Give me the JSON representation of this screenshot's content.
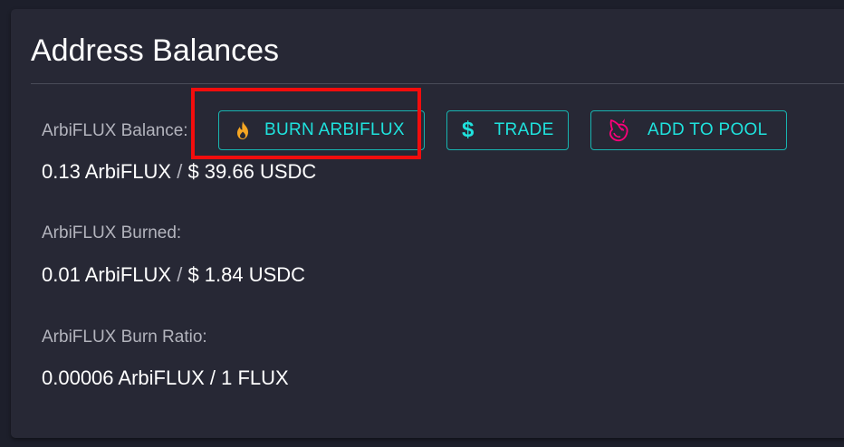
{
  "card": {
    "title": "Address Balances"
  },
  "balance": {
    "label": "ArbiFLUX Balance:",
    "amount": "0.13 ArbiFLUX",
    "separator": "/",
    "usdc": "$ 39.66 USDC"
  },
  "burned": {
    "label": "ArbiFLUX Burned:",
    "amount": "0.01 ArbiFLUX",
    "separator": "/",
    "usdc": "$ 1.84 USDC"
  },
  "ratio": {
    "label": "ArbiFLUX Burn Ratio:",
    "value": "0.00006 ArbiFLUX / 1 FLUX"
  },
  "buttons": {
    "burn": {
      "label": "BURN ARBIFLUX",
      "icon": "flame-icon"
    },
    "trade": {
      "label": "TRADE",
      "icon": "dollar-icon",
      "glyph": "$"
    },
    "pool": {
      "label": "ADD TO POOL",
      "icon": "unicorn-icon"
    }
  },
  "colors": {
    "accent": "#1fe2dd",
    "flame": "#f5a623",
    "unicorn": "#ff007a",
    "highlight": "#f20d0d",
    "card_bg": "#272835",
    "page_bg": "#1d1f2b"
  }
}
